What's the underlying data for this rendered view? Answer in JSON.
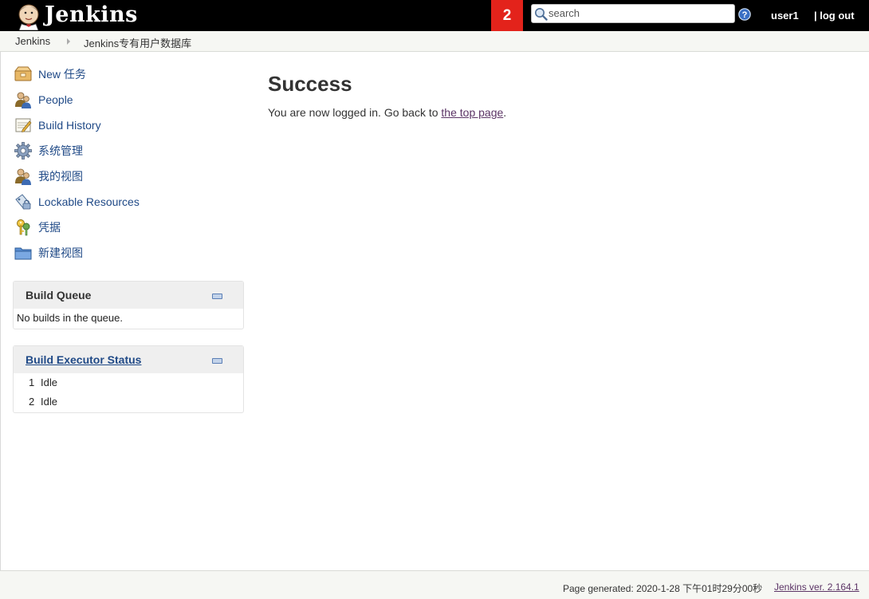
{
  "header": {
    "app_name": "Jenkins",
    "notification_count": "2",
    "search_placeholder": "search",
    "search_value": "",
    "user": "user1",
    "logout": "| log out",
    "colors": {
      "bar": "#000000",
      "badge": "#e3231b"
    }
  },
  "breadcrumb": [
    {
      "label": "Jenkins"
    },
    {
      "label": "Jenkins专有用户数据库"
    }
  ],
  "sidebar": {
    "tasks": [
      {
        "label": "New 任务",
        "icon": "new-item-icon"
      },
      {
        "label": "People",
        "icon": "people-icon"
      },
      {
        "label": "Build History",
        "icon": "build-history-icon"
      },
      {
        "label": "系统管理",
        "icon": "gear-icon"
      },
      {
        "label": "我的视图",
        "icon": "my-views-icon"
      },
      {
        "label": "Lockable Resources",
        "icon": "lockable-resources-icon"
      },
      {
        "label": "凭据",
        "icon": "credentials-icon"
      },
      {
        "label": "新建视图",
        "icon": "folder-icon"
      }
    ],
    "build_queue": {
      "title": "Build Queue",
      "empty_text": "No builds in the queue."
    },
    "executors": {
      "title": "Build Executor Status",
      "rows": [
        {
          "num": "1",
          "status": "Idle"
        },
        {
          "num": "2",
          "status": "Idle"
        }
      ]
    }
  },
  "main": {
    "title": "Success",
    "message_prefix": "You are now logged in. Go back to ",
    "link_text": "the top page",
    "message_suffix": "."
  },
  "footer": {
    "generated": "Page generated: 2020-1-28 下午01时29分00秒",
    "version": "Jenkins ver. 2.164.1"
  },
  "colors": {
    "link": "#204a87",
    "visited_link": "#5c3566",
    "breadcrumb_bg": "#f6f7f3"
  }
}
